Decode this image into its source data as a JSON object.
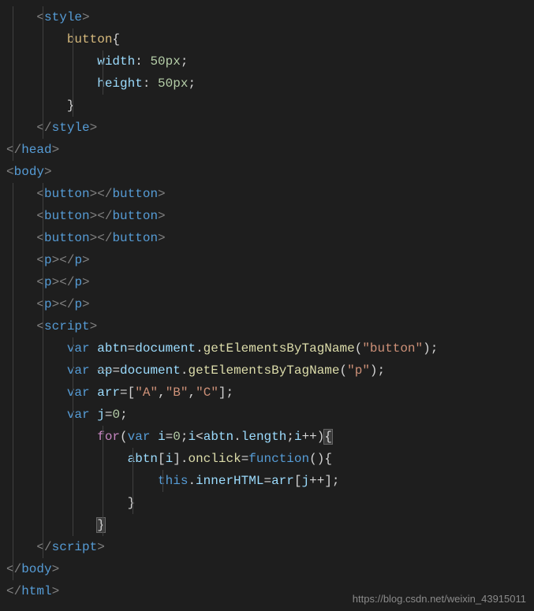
{
  "code": {
    "style_open": "style",
    "style_close": "style",
    "selector_button": "button",
    "prop_width": "width",
    "val_width_num": "50",
    "val_width_unit": "px",
    "prop_height": "height",
    "val_height_num": "50",
    "val_height_unit": "px",
    "head_close": "head",
    "body_open": "body",
    "body_close": "body",
    "html_close": "html",
    "button_tag": "button",
    "p_tag": "p",
    "script_tag": "script",
    "kw_var": "var",
    "kw_for": "for",
    "kw_this": "this",
    "kw_function": "function",
    "id_abtn": "abtn",
    "id_ap": "ap",
    "id_arr": "arr",
    "id_j": "j",
    "id_i": "i",
    "id_document": "document",
    "fn_getElementsByTagName": "getElementsByTagName",
    "id_length": "length",
    "id_onclick": "onclick",
    "id_innerHTML": "innerHTML",
    "str_button": "\"button\"",
    "str_p": "\"p\"",
    "arr_a": "\"A\"",
    "arr_b": "\"B\"",
    "arr_c": "\"C\"",
    "num_0": "0",
    "op_eq": "=",
    "op_inc": "++",
    "op_lt": "<",
    "semi": ";",
    "colon": ":",
    "dot": ".",
    "comma": ",",
    "lbrace": "{",
    "rbrace": "}",
    "lparen": "(",
    "rparen": ")",
    "lbracket": "[",
    "rbracket": "]"
  },
  "watermark": "https://blog.csdn.net/weixin_43915011"
}
